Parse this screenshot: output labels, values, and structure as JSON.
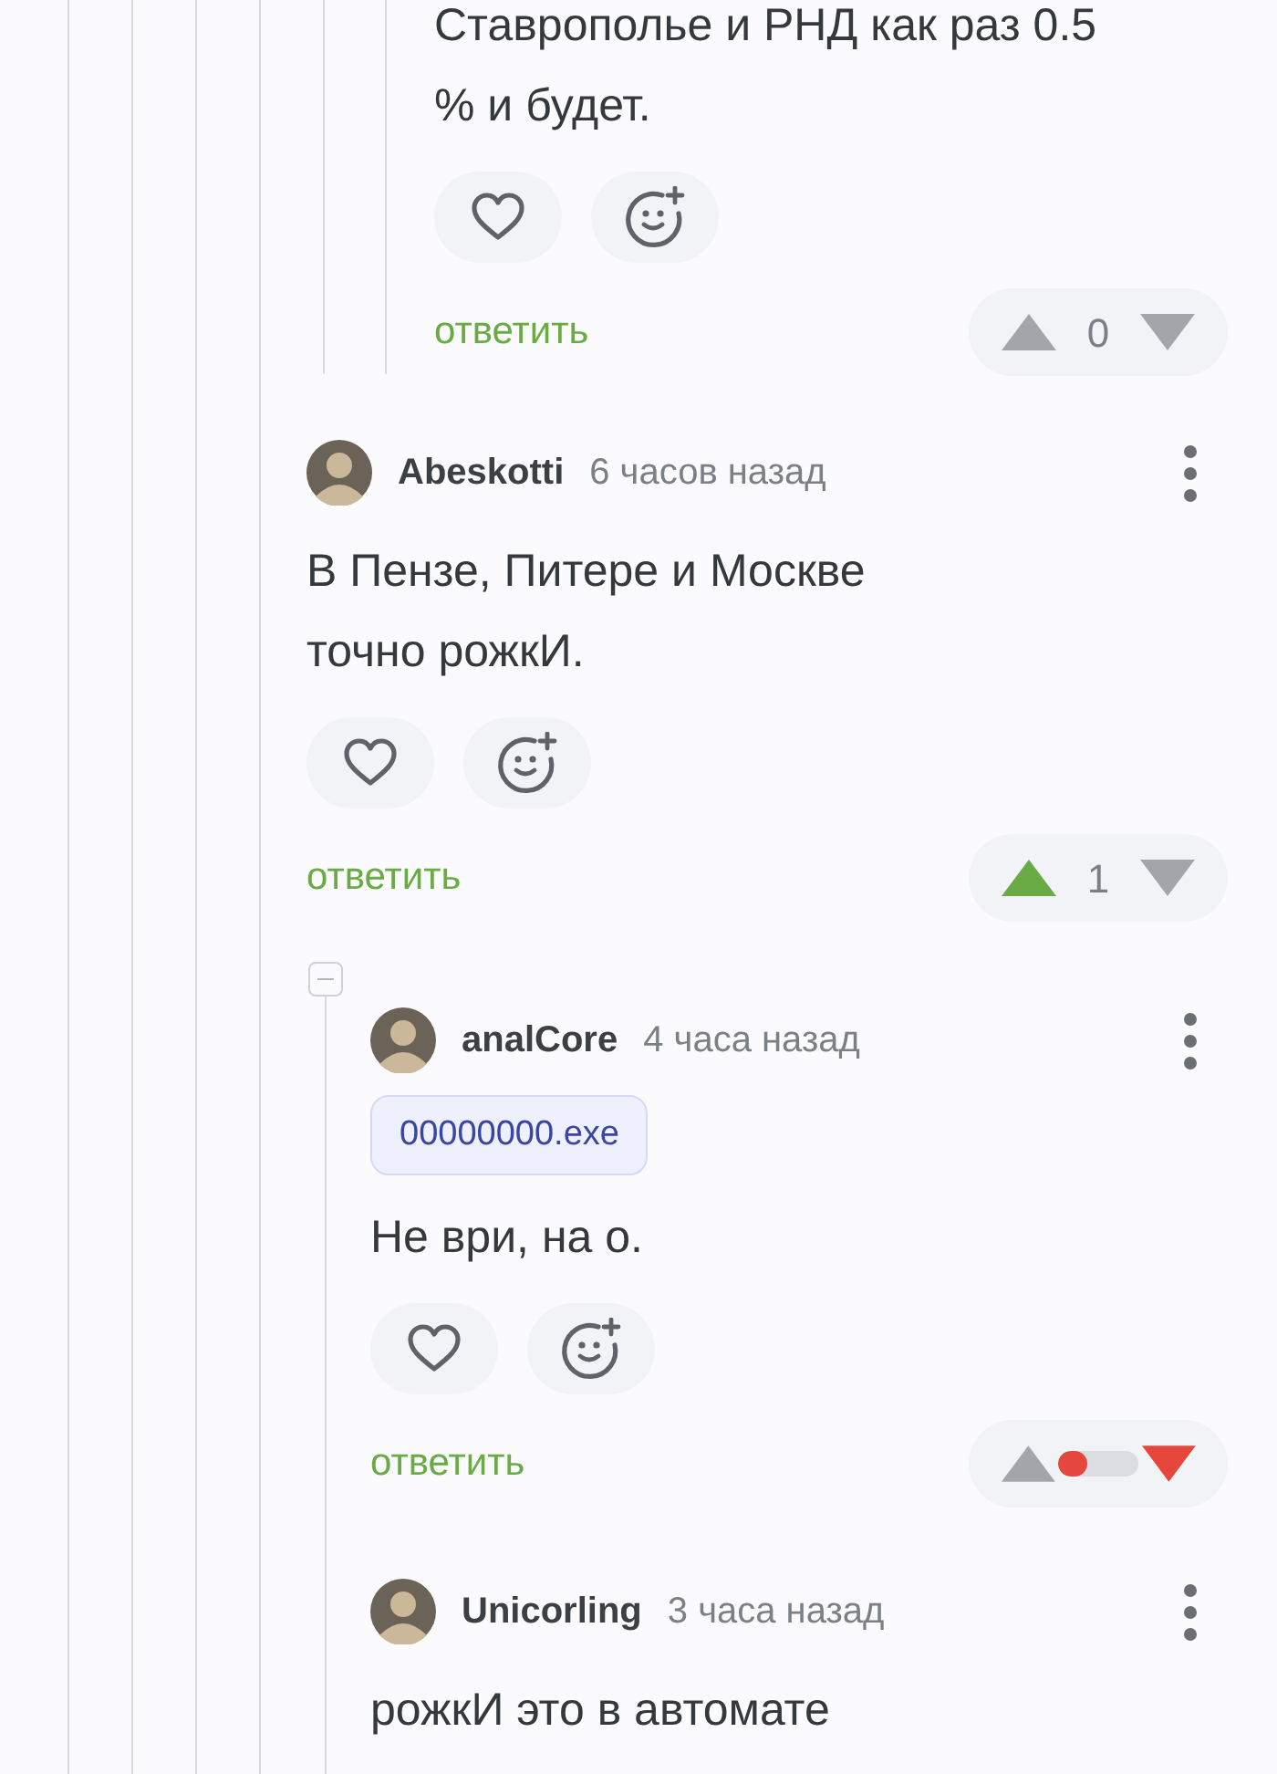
{
  "comments": [
    {
      "kind": "partial",
      "lines": [
        "Ставрополье и РНД как раз 0.5",
        "% и будет."
      ],
      "reply": "ответить",
      "vote": {
        "kind": "score",
        "score": "0",
        "up": false,
        "down": false
      }
    },
    {
      "kind": "full",
      "author": "Abeskotti",
      "time": "6 часов назад",
      "lines": [
        "В Пензе, Питере и Москве",
        "точно рожкИ."
      ],
      "reply": "ответить",
      "vote": {
        "kind": "score",
        "score": "1",
        "up": true,
        "down": false
      },
      "expanded": true,
      "children": [
        {
          "kind": "full",
          "author": "analCore",
          "time": "4 часа назад",
          "tag": "00000000.exe",
          "lines": [
            "Не ври, на о."
          ],
          "reply": "ответить",
          "vote": {
            "kind": "bar",
            "level": 0.35,
            "up": false,
            "down": true
          }
        },
        {
          "kind": "full",
          "author": "Unicorling",
          "time": "3 часа назад",
          "lines": [
            "рожкИ это в автомате"
          ]
        }
      ]
    }
  ]
}
